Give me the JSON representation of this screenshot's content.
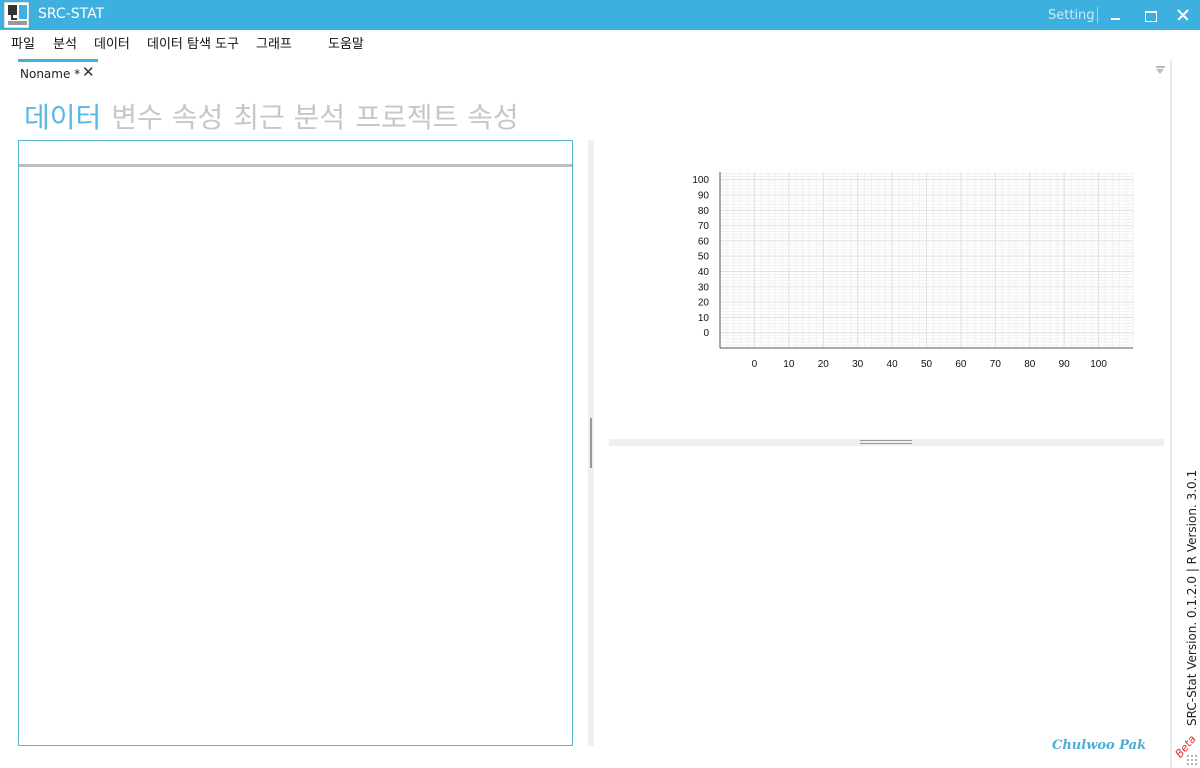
{
  "window": {
    "title": "SRC-STAT",
    "setting_label": "Setting"
  },
  "menu": [
    "파일",
    "분석",
    "데이터",
    "데이터 탐색 도구",
    "그래프",
    "도움말"
  ],
  "document_tab": {
    "label": "Noname *",
    "close_glyph": "✕"
  },
  "section_tabs": [
    {
      "label": "데이터",
      "active": true
    },
    {
      "label": "변수 속성",
      "active": false
    },
    {
      "label": "최근 분석",
      "active": false
    },
    {
      "label": "프로젝트 속성",
      "active": false
    }
  ],
  "footer": {
    "version_text": "SRC-Stat Version. 0.1.2.0  |  R Version. 3.0.1",
    "beta_label": "Beta",
    "author": "Chulwoo Pak"
  },
  "colors": {
    "accent": "#3db0e0",
    "active_tab": "#58b9e3",
    "inactive_tab": "#c7c7c7",
    "beta": "#e53030"
  },
  "chart_data": {
    "type": "scatter",
    "x_ticks": [
      0,
      10,
      20,
      30,
      40,
      50,
      60,
      70,
      80,
      90,
      100
    ],
    "y_ticks": [
      0,
      10,
      20,
      30,
      40,
      50,
      60,
      70,
      80,
      90,
      100
    ],
    "xlim": [
      0,
      100
    ],
    "ylim": [
      0,
      100
    ],
    "grid": true,
    "series": []
  }
}
